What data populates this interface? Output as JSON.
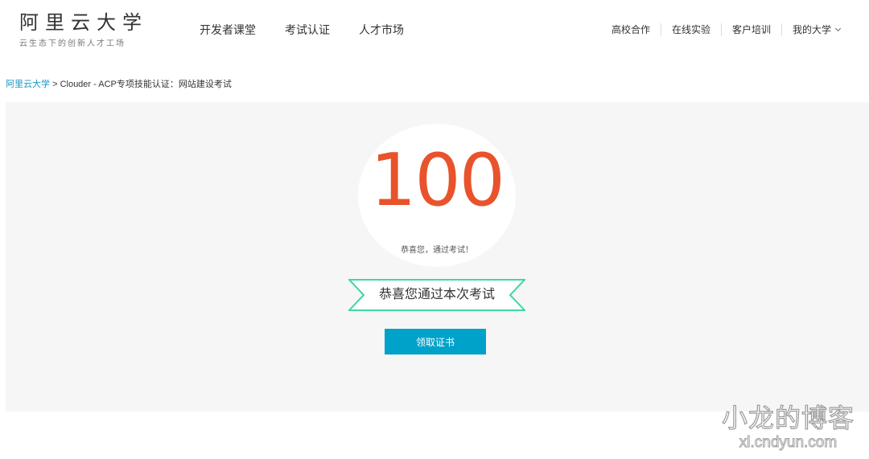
{
  "logo": {
    "title": "阿里云大学",
    "subtitle": "云生态下的创新人才工场"
  },
  "main_nav": {
    "items": [
      "开发者课堂",
      "考试认证",
      "人才市场"
    ]
  },
  "right_nav": {
    "items": [
      "高校合作",
      "在线实验",
      "客户培训",
      "我的大学"
    ]
  },
  "breadcrumb": {
    "home": "阿里云大学",
    "separator": ">",
    "current": "Clouder - ACP专项技能认证：网站建设考试"
  },
  "result": {
    "score": "100",
    "caption": "恭喜您，通过考试！",
    "ribbon_text": "恭喜您通过本次考试",
    "cert_button": "领取证书"
  },
  "watermark": {
    "title": "小龙的博客",
    "url": "xl.cndyun.com"
  },
  "colors": {
    "score": "#e8532c",
    "button": "#00a2ca",
    "link": "#1a96c9",
    "ribbon_border": "#40d6a8",
    "panel_bg": "#f6f6f6"
  }
}
